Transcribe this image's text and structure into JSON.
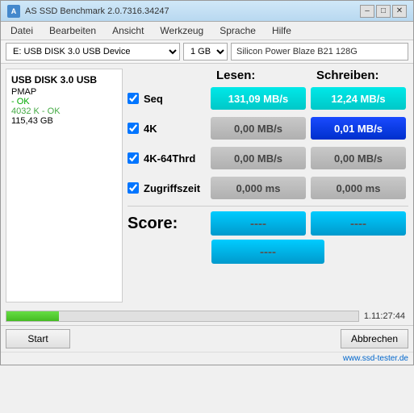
{
  "window": {
    "title": "AS SSD Benchmark 2.0.7316.34247",
    "icon": "A"
  },
  "title_buttons": {
    "minimize": "–",
    "maximize": "□",
    "close": "✕"
  },
  "menu": {
    "items": [
      "Datei",
      "Bearbeiten",
      "Ansicht",
      "Werkzeug",
      "Sprache",
      "Hilfe"
    ]
  },
  "toolbar": {
    "device": "E: USB DISK 3.0 USB Device",
    "size": "1 GB",
    "device_name": "Silicon Power Blaze B21 128G"
  },
  "left_panel": {
    "title": "USB DISK 3.0 USB",
    "pmap": "PMAP",
    "status1": "- OK",
    "status2": "4032 K - OK",
    "size": "115,43 GB"
  },
  "benchmark": {
    "read_label": "Lesen:",
    "write_label": "Schreiben:",
    "rows": [
      {
        "label": "Seq",
        "checked": true,
        "read": "131,09 MB/s",
        "write": "12,24 MB/s",
        "read_style": "cyan",
        "write_style": "cyan"
      },
      {
        "label": "4K",
        "checked": true,
        "read": "0,00 MB/s",
        "write": "0,01 MB/s",
        "read_style": "gray",
        "write_style": "blue"
      },
      {
        "label": "4K-64Thrd",
        "checked": true,
        "read": "0,00 MB/s",
        "write": "0,00 MB/s",
        "read_style": "gray",
        "write_style": "gray"
      },
      {
        "label": "Zugriffszeit",
        "checked": true,
        "read": "0,000 ms",
        "write": "0,000 ms",
        "read_style": "gray",
        "write_style": "gray"
      }
    ]
  },
  "score": {
    "label": "Score:",
    "read": "----",
    "write": "----",
    "total": "----"
  },
  "progress": {
    "percent": 15,
    "time": "1.11:27:44"
  },
  "buttons": {
    "start": "Start",
    "cancel": "Abbrechen"
  },
  "watermark": "www.ssd-tester.de"
}
